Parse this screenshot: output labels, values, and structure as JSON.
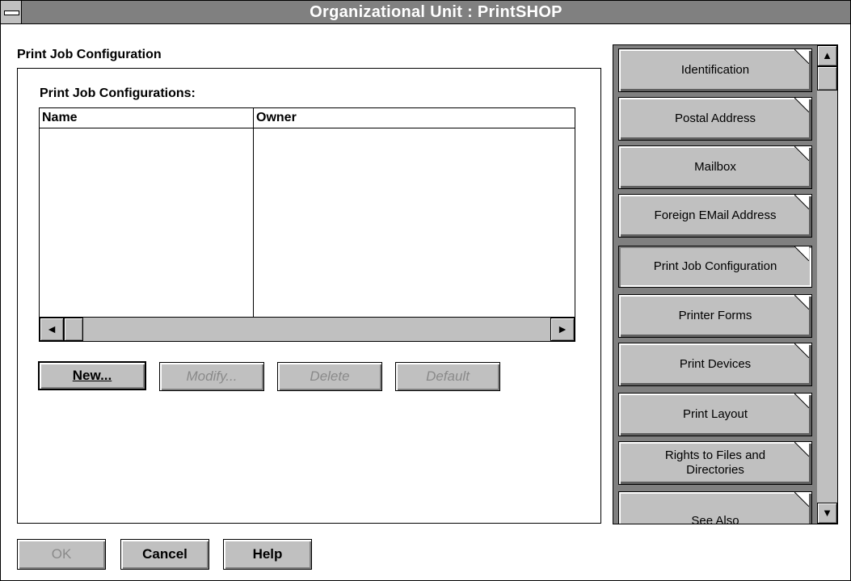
{
  "window": {
    "title": "Organizational Unit : PrintSHOP"
  },
  "section": {
    "title": "Print Job Configuration"
  },
  "list": {
    "label": "Print Job Configurations:",
    "columns": [
      "Name",
      "Owner"
    ],
    "rows": []
  },
  "actions": {
    "new": "New...",
    "modify": "Modify...",
    "delete": "Delete",
    "default": "Default"
  },
  "pages": [
    "Identification",
    "Postal Address",
    "Mailbox",
    "Foreign EMail Address",
    "Print Job Configuration",
    "Printer Forms",
    "Print Devices",
    "Print Layout",
    "Rights to Files and Directories",
    "See Also"
  ],
  "active_page": "Print Job Configuration",
  "footer": {
    "ok": "OK",
    "cancel": "Cancel",
    "help": "Help"
  },
  "icons": {
    "scroll_left": "◄",
    "scroll_right": "►",
    "scroll_up": "▲",
    "scroll_down": "▼"
  }
}
